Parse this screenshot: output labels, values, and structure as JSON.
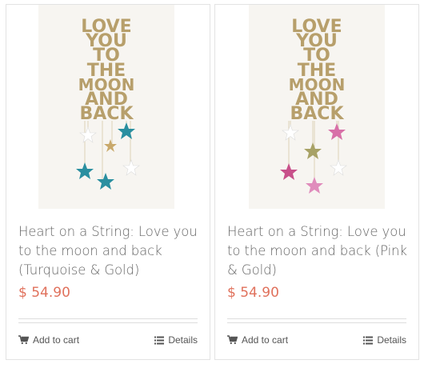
{
  "products": [
    {
      "image_text": [
        "LOVE",
        "YOU",
        "TO",
        "THE",
        "MOON",
        "AND",
        "BACK"
      ],
      "title": "Heart on a String: Love you to the moon and back (Turquoise & Gold)",
      "price": "$ 54.90",
      "add_to_cart": "Add to cart",
      "details": "Details",
      "star_colors": [
        "#2a8fa0",
        "#c9a96b",
        "#ffffff"
      ]
    },
    {
      "image_text": [
        "LOVE",
        "YOU",
        "TO",
        "THE",
        "MOON",
        "AND",
        "BACK"
      ],
      "title": "Heart on a String: Love you to the moon and back (Pink & Gold)",
      "price": "$ 54.90",
      "add_to_cart": "Add to cart",
      "details": "Details",
      "star_colors": [
        "#d870a8",
        "#a8a266",
        "#ffffff"
      ]
    }
  ],
  "colors": {
    "price": "#e0715c",
    "title": "#666666",
    "card_border": "#e3e3e3"
  },
  "icons": {
    "cart": "cart-icon",
    "details": "list-icon"
  }
}
